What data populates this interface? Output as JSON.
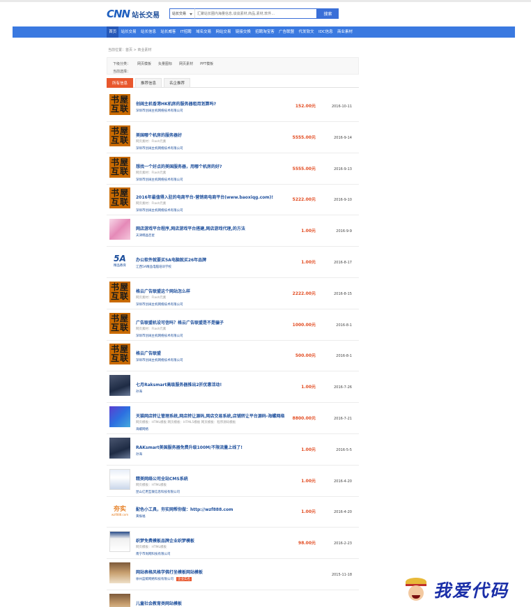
{
  "header": {
    "logo_mark": "CNN",
    "logo_text": "站长交易",
    "search_select": "站长交易",
    "search_placeholder": "汇聚站长圈内海量信息,谈谈素材,商品,素材,软件...",
    "search_button": "搜索"
  },
  "nav": {
    "items": [
      {
        "label": "首页",
        "active": true
      },
      {
        "label": "站长交易",
        "active": false
      },
      {
        "label": "站长信息",
        "active": false
      },
      {
        "label": "站长威客",
        "active": false
      },
      {
        "label": "IT招聘",
        "active": false
      },
      {
        "label": "域名交易",
        "active": false
      },
      {
        "label": "网站交易",
        "active": false
      },
      {
        "label": "链接交换",
        "active": false
      },
      {
        "label": "招聘淘宝客",
        "active": false
      },
      {
        "label": "广告联盟",
        "active": false
      },
      {
        "label": "代发软文",
        "active": false
      },
      {
        "label": "IDC信息",
        "active": false
      },
      {
        "label": "商业素材",
        "active": false
      }
    ]
  },
  "breadcrumb": "当前位置：首页 > 商业素材",
  "filter": {
    "label1": "下级分类：",
    "categories": [
      "网页模板",
      "矢量图标",
      "网页素材",
      "PPT模板"
    ],
    "label2": "当前选择："
  },
  "tabs": [
    {
      "label": "所有信息",
      "active": true
    },
    {
      "label": "推荐信息",
      "active": false
    },
    {
      "label": "名企推荐",
      "active": false
    }
  ],
  "listings": [
    {
      "thumb": "book",
      "title": "创阔主机香港HK机房的服务器租用划算吗?",
      "meta": "",
      "company": "深圳市创阔主机网络技术有限公司",
      "price": "152.00元",
      "date": "2016-10-11"
    },
    {
      "thumb": "book",
      "title": "美国哪个机房的服务器好",
      "meta": "网页素材：Flash元素",
      "company": "深圳市创阔主机网络技术有限公司",
      "price": "5555.00元",
      "date": "2016-9-14"
    },
    {
      "thumb": "book",
      "title": "想找一个好点的美国服务器，用哪个机房的好?",
      "meta": "网页素材：Flash元素",
      "company": "深圳市创阔主机网络技术有限公司",
      "price": "5555.00元",
      "date": "2016-9-13"
    },
    {
      "thumb": "book",
      "title": "2016年最值得入驻的电商平台-营销商电商平台(www.baoxiqg.com)!",
      "meta": "网页素材：Flash元素",
      "company": "深圳市创阔主机网络技术有限公司",
      "price": "5222.00元",
      "date": "2016-9-10"
    },
    {
      "thumb": "pink",
      "title": "网店游戏平台程序,网店游戏平台搭建,网店游戏代理,的方法",
      "meta": "",
      "company": "天津韩晶巨星",
      "price": "1.00元",
      "date": "2016-9-9"
    },
    {
      "thumb": "5a",
      "title": "办公软件就要买5A电脑就买26年品牌",
      "meta": "",
      "company": "江西5A精品电脑培训学校",
      "price": "1.00元",
      "date": "2016-8-17"
    },
    {
      "thumb": "book",
      "title": "格云广告联盟这个网站怎么样",
      "meta": "网页素材：Flash元素",
      "company": "深圳市创阔主机网络技术有限公司",
      "price": "2222.00元",
      "date": "2016-8-15"
    },
    {
      "thumb": "book",
      "title": "广告联盟机设可信吗？格云广告联盟是不是骗子",
      "meta": "网页素材：Flash元素",
      "company": "深圳市创阔主机网络技术有限公司",
      "price": "1000.00元",
      "date": "2016-8-1"
    },
    {
      "thumb": "book",
      "title": "格云广告联盟",
      "meta": "",
      "company": "深圳市创阔主机网络技术有限公司",
      "price": "500.00元",
      "date": "2016-8-1"
    },
    {
      "thumb": "dark",
      "title": "七月Raksmart高级服务器推出2折优惠活动!",
      "meta": "",
      "company": "孙海",
      "price": "1.00元",
      "date": "2016-7-26"
    },
    {
      "thumb": "blue",
      "title": "天猫网店转让管理系统,网店转让源码,网店交易系统,店铺转让平台源码-海螺网络",
      "meta": "网页模板：HTML模板 网页模板：HTML5模板 网页模板：程序源码模板",
      "company": "海螺网络",
      "price": "8800.00元",
      "date": "2016-7-21"
    },
    {
      "thumb": "dark",
      "title": "RAKsmart美国服务器免费升级100M/不限流量上线了!",
      "meta": "",
      "company": "孙海",
      "price": "1.00元",
      "date": "2016-5-5"
    },
    {
      "thumb": "web",
      "title": "精美网络公司全站CMS系统",
      "meta": "网页模板：HTML模板",
      "company": "昆山亿用互联信息科技有限公司",
      "price": "1.00元",
      "date": "2016-4-20"
    },
    {
      "thumb": "cal",
      "title": "配色小工具，夯实网帮你做：http://wzf888.com",
      "meta": "",
      "company": "黄振福",
      "price": "1.00元",
      "date": "2016-4-20"
    },
    {
      "thumb": "web2",
      "title": "织梦免费模板品牌企业织梦模板",
      "meta": "网页模板：HTML模板",
      "company": "南宁市尚网科技有限公司",
      "price": "98.00元",
      "date": "2016-2-23"
    },
    {
      "thumb": "photo",
      "title": "网站表格风格学佛打坐模板网站模板",
      "meta": "",
      "company": "徐州蓝鲸网络科技有限公司",
      "badge": "企业实名",
      "price": "",
      "date": "2015-11-18"
    },
    {
      "thumb": "photo",
      "title": "儿童社会教育类网站模板",
      "meta": "",
      "company": "",
      "price": "",
      "date": ""
    }
  ],
  "watermark": {
    "text": "我爱代码"
  }
}
